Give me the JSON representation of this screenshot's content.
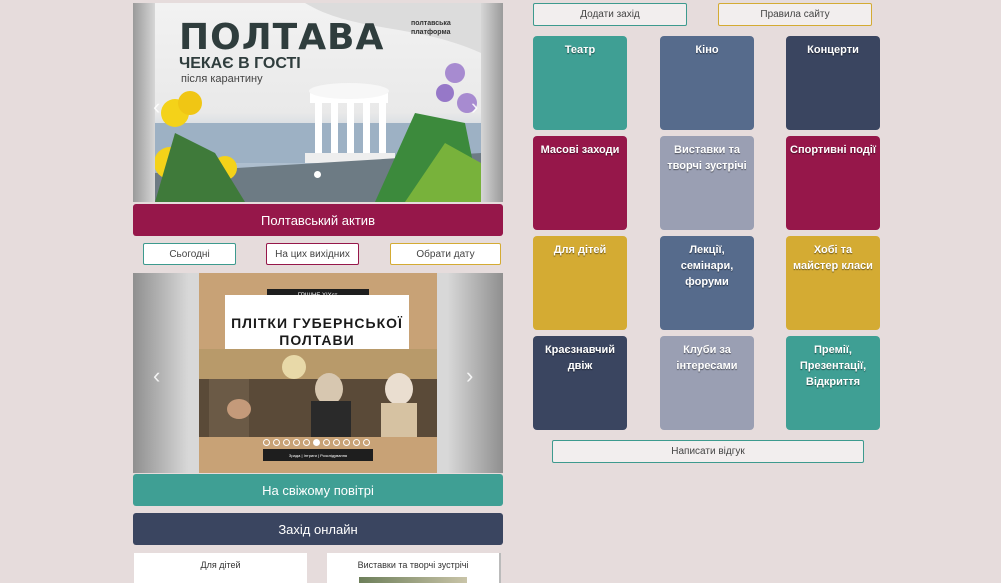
{
  "banner": {
    "title": "ПОЛТАВА",
    "subtitle": "ЧЕКАЄ В ГОСТІ",
    "tagline": "після карантину",
    "brand": "полтавська\nплатформа"
  },
  "buttons": {
    "active": "Полтавський актив",
    "fresh_air": "На свіжому повітрі",
    "online": "Захід онлайн",
    "add_event": "Додати захід",
    "rules": "Правила сайту",
    "feedback": "Написати відгук"
  },
  "filters": {
    "today": "Сьогодні",
    "weekend": "На цих вихідних",
    "pick_date": "Обрати дату"
  },
  "poster": {
    "badge": "ГРІШНЕ ХІХст.",
    "title": "ПЛІТКИ ГУБЕРНСЬКОЇ ПОЛТАВИ",
    "footer": "Зрада | Інтриги | Розслідування"
  },
  "categories": [
    {
      "label": "Театр"
    },
    {
      "label": "Кіно"
    },
    {
      "label": "Концерти"
    },
    {
      "label": "Масові заходи"
    },
    {
      "label": "Виставки та творчі зустрічі"
    },
    {
      "label": "Спортивні події"
    },
    {
      "label": "Для дітей"
    },
    {
      "label": "Лекції, семінари, форуми"
    },
    {
      "label": "Хобі та майстер класи"
    },
    {
      "label": "Краєзнавчий двіж"
    },
    {
      "label": "Клуби за інтересами"
    },
    {
      "label": "Премії, Презентації, Відкриття"
    }
  ],
  "bottom_cards": [
    {
      "label": "Для дітей"
    },
    {
      "label": "Виставки та творчі зустрічі"
    }
  ],
  "colors": {
    "teal": "#3f9f94",
    "slate": "#566b8c",
    "navy": "#3a4560",
    "crimson": "#96174a",
    "grey": "#9a9fb3",
    "gold": "#d4ab33"
  }
}
